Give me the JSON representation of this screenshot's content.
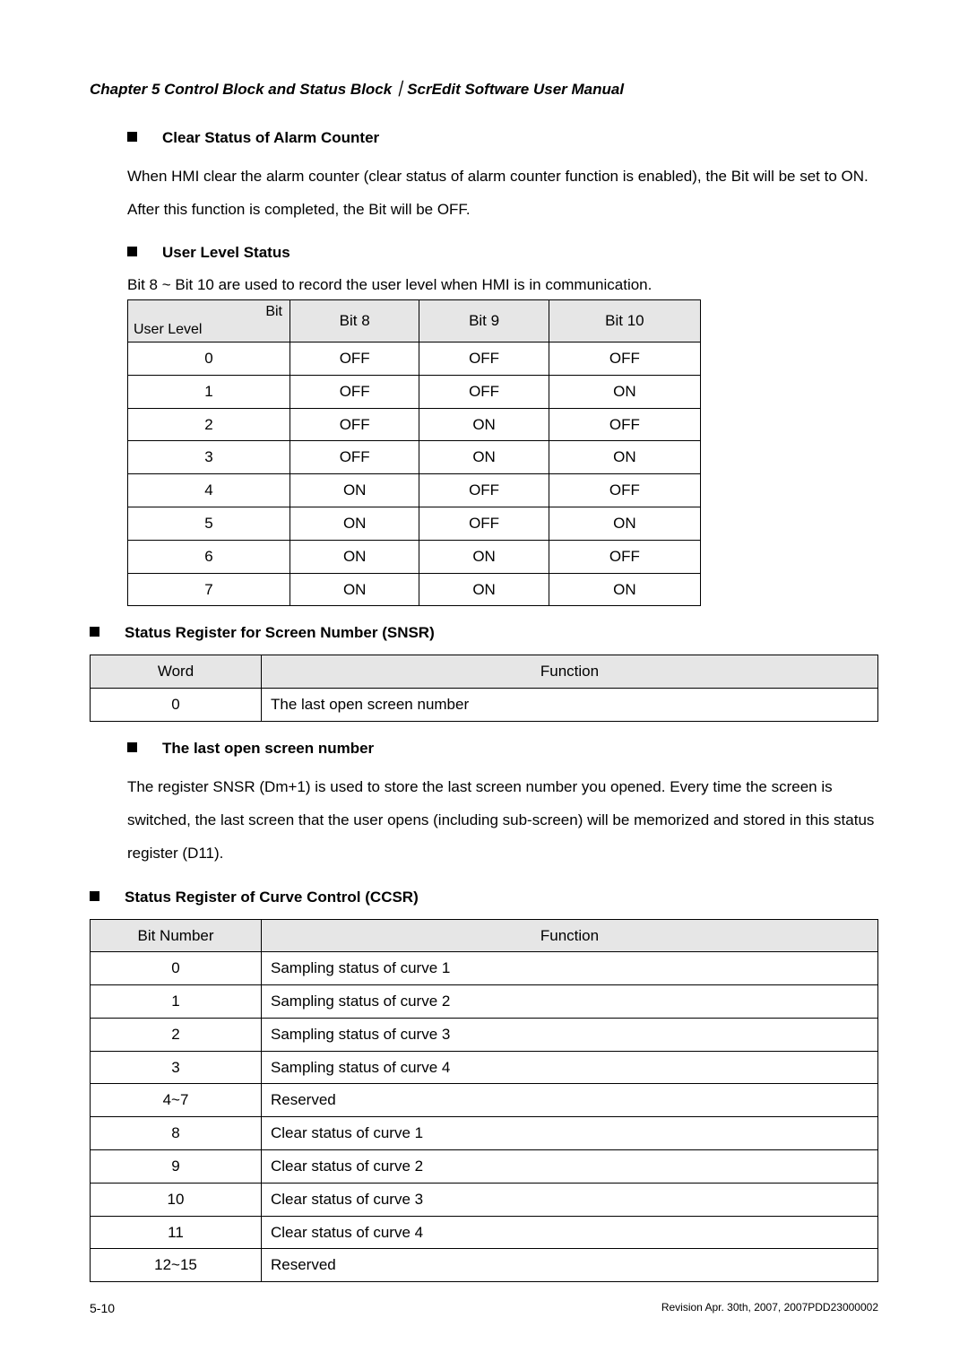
{
  "header": {
    "chapter_line": "Chapter 5  Control Block and Status Block｜ScrEdit Software User Manual"
  },
  "sec_clear_status": {
    "heading": "Clear Status of Alarm Counter",
    "para": "When HMI clear the alarm counter (clear status of alarm counter function is enabled), the Bit will be set to ON. After this function is completed, the Bit will be OFF."
  },
  "sec_user_level": {
    "heading": "User Level Status",
    "note": "Bit 8 ~ Bit 10 are used to record the user level when HMI is in communication.",
    "diag_top": "Bit",
    "diag_bottom": "User Level",
    "cols": [
      "Bit 8",
      "Bit 9",
      "Bit 10"
    ],
    "rows": [
      {
        "lvl": "0",
        "c": [
          "OFF",
          "OFF",
          "OFF"
        ]
      },
      {
        "lvl": "1",
        "c": [
          "OFF",
          "OFF",
          "ON"
        ]
      },
      {
        "lvl": "2",
        "c": [
          "OFF",
          "ON",
          "OFF"
        ]
      },
      {
        "lvl": "3",
        "c": [
          "OFF",
          "ON",
          "ON"
        ]
      },
      {
        "lvl": "4",
        "c": [
          "ON",
          "OFF",
          "OFF"
        ]
      },
      {
        "lvl": "5",
        "c": [
          "ON",
          "OFF",
          "ON"
        ]
      },
      {
        "lvl": "6",
        "c": [
          "ON",
          "ON",
          "OFF"
        ]
      },
      {
        "lvl": "7",
        "c": [
          "ON",
          "ON",
          "ON"
        ]
      }
    ]
  },
  "sec_snsr": {
    "heading": "Status Register for Screen Number (SNSR)",
    "col_word": "Word",
    "col_func": "Function",
    "row": {
      "word": "0",
      "func": "The last open screen number"
    }
  },
  "sec_last_open": {
    "heading": "The last open screen number",
    "para": "The register SNSR (Dm+1) is used to store the last screen number you opened. Every time the screen is switched, the last screen that the user opens (including sub-screen) will be memorized and stored in this status register (D11)."
  },
  "sec_ccsr": {
    "heading": "Status Register of Curve Control (CCSR)",
    "col_bit": "Bit Number",
    "col_func": "Function",
    "rows": [
      {
        "bit": "0",
        "func": "Sampling status of curve 1"
      },
      {
        "bit": "1",
        "func": "Sampling status of curve 2"
      },
      {
        "bit": "2",
        "func": "Sampling status of curve 3"
      },
      {
        "bit": "3",
        "func": "Sampling status of curve 4"
      },
      {
        "bit": "4~7",
        "func": "Reserved"
      },
      {
        "bit": "8",
        "func": "Clear status of curve 1"
      },
      {
        "bit": "9",
        "func": "Clear status of curve 2"
      },
      {
        "bit": "10",
        "func": "Clear status of curve 3"
      },
      {
        "bit": "11",
        "func": "Clear status of curve 4"
      },
      {
        "bit": "12~15",
        "func": "Reserved"
      }
    ]
  },
  "footer": {
    "page": "5-10",
    "rev": "Revision Apr. 30th, 2007, 2007PDD23000002"
  }
}
